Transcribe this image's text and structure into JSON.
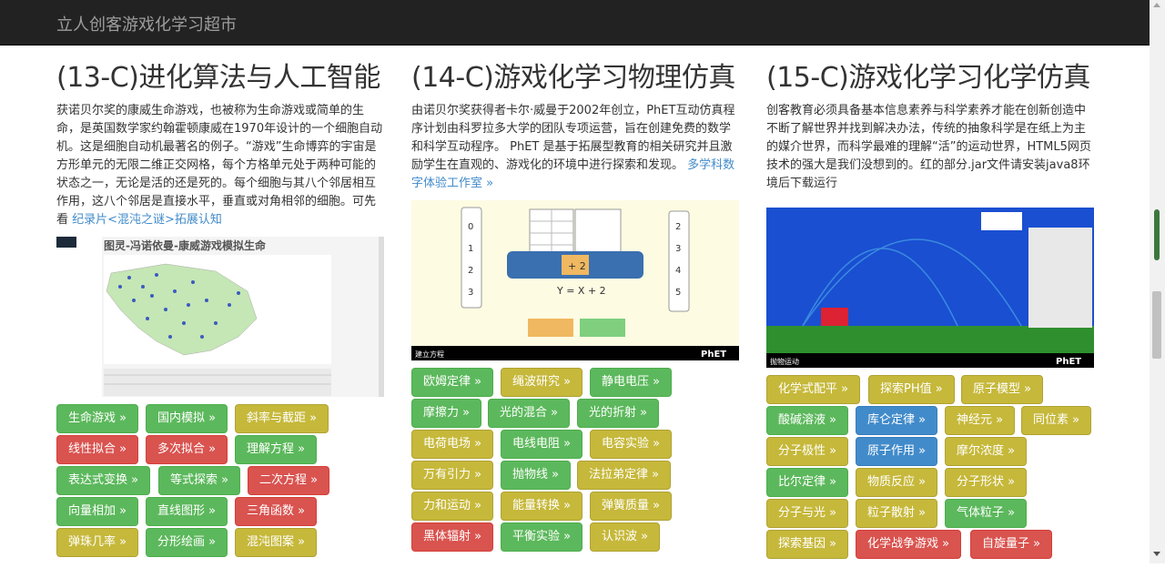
{
  "navbar": {
    "brand": "立人创客游戏化学习超市"
  },
  "columns": [
    {
      "title": "(13-C)进化算法与人工智能",
      "text": "获诺贝尔奖的康威生命游戏，也被称为生命游戏或简单的生命，是英国数学家约翰霍顿康威在1970年设计的一个细胞自动机。这是细胞自动机最著名的例子。“游戏”生命博弈的宇宙是方形单元的无限二维正交网格，每个方格单元处于两种可能的状态之一，无论是活的还是死的。每个细胞与其八个邻居相互作用，这八个邻居是直接水平，垂直或对角相邻的细胞。可先看 ",
      "link": "纪录片<混沌之谜>拓展认知",
      "figure_title": "图灵-冯诺依曼-康威游戏模拟生命",
      "buttons": [
        {
          "label": "生命游戏 »",
          "color": "green"
        },
        {
          "label": "国内模拟 »",
          "color": "green"
        },
        {
          "label": "斜率与截距 »",
          "color": "yellow"
        },
        {
          "label": "线性拟合 »",
          "color": "red"
        },
        {
          "label": "多次拟合 »",
          "color": "red"
        },
        {
          "label": "理解方程 »",
          "color": "green"
        },
        {
          "label": "表达式变换 »",
          "color": "green"
        },
        {
          "label": "等式探索 »",
          "color": "green"
        },
        {
          "label": "二次方程 »",
          "color": "red"
        },
        {
          "label": "向量相加 »",
          "color": "green"
        },
        {
          "label": "直线图形 »",
          "color": "green"
        },
        {
          "label": "三角函数 »",
          "color": "red"
        },
        {
          "label": "弹珠几率 »",
          "color": "yellow"
        },
        {
          "label": "分形绘画 »",
          "color": "green"
        },
        {
          "label": "混沌图案 »",
          "color": "yellow"
        }
      ]
    },
    {
      "title": "(14-C)游戏化学习物理仿真",
      "text": "由诺贝尔奖获得者卡尔·威曼于2002年创立，PhET互动仿真程序计划由科罗拉多大学的团队专项运营，旨在创建免费的数学和科学互动程序。 PhET 是基于拓展型教育的相关研究并且激励学生在直观的、游戏化的环境中进行探索和发现。 ",
      "link": "多学科数字体验工作室 »",
      "figure_equation": "Y = X + 2",
      "figure_label": "建立方程",
      "figure_brand": "PhET",
      "buttons": [
        {
          "label": "欧姆定律 »",
          "color": "green"
        },
        {
          "label": "绳波研究 »",
          "color": "yellow"
        },
        {
          "label": "静电电压 »",
          "color": "green"
        },
        {
          "label": "摩擦力 »",
          "color": "green"
        },
        {
          "label": "光的混合 »",
          "color": "green"
        },
        {
          "label": "光的折射 »",
          "color": "green"
        },
        {
          "label": "电荷电场 »",
          "color": "yellow"
        },
        {
          "label": "电线电阻 »",
          "color": "green"
        },
        {
          "label": "电容实验 »",
          "color": "yellow"
        },
        {
          "label": "万有引力 »",
          "color": "yellow"
        },
        {
          "label": "抛物线 »",
          "color": "green"
        },
        {
          "label": "法拉弟定律 »",
          "color": "yellow"
        },
        {
          "label": "力和运动 »",
          "color": "yellow"
        },
        {
          "label": "能量转换 »",
          "color": "yellow"
        },
        {
          "label": "弹簧质量 »",
          "color": "yellow"
        },
        {
          "label": "黑体辐射 »",
          "color": "red"
        },
        {
          "label": "平衡实验 »",
          "color": "green"
        },
        {
          "label": "认识波 »",
          "color": "yellow"
        }
      ]
    },
    {
      "title": "(15-C)游戏化学习化学仿真",
      "text": "创客教育必须具备基本信息素养与科学素养才能在创新创造中不断了解世界并找到解决办法，传统的抽象科学是在纸上为主的媒介世界，而科学最难的理解“活”的运动世界，HTML5网页技术的强大是我们没想到的。红的部分.jar文件请安装java8环境后下载运行",
      "figure_label": "抛物运动",
      "figure_brand": "PhET",
      "buttons": [
        {
          "label": "化学式配平 »",
          "color": "yellow"
        },
        {
          "label": "探索PH值 »",
          "color": "yellow"
        },
        {
          "label": "原子模型 »",
          "color": "yellow"
        },
        {
          "label": "酸碱溶液 »",
          "color": "green"
        },
        {
          "label": "库仑定律 »",
          "color": "blue"
        },
        {
          "label": "神经元 »",
          "color": "yellow"
        },
        {
          "label": "同位素 »",
          "color": "yellow"
        },
        {
          "label": "分子极性 »",
          "color": "yellow"
        },
        {
          "label": "原子作用 »",
          "color": "blue"
        },
        {
          "label": "摩尔浓度 »",
          "color": "yellow"
        },
        {
          "label": "比尔定律 »",
          "color": "green"
        },
        {
          "label": "物质反应 »",
          "color": "yellow"
        },
        {
          "label": "分子形状 »",
          "color": "yellow"
        },
        {
          "label": "分子与光 »",
          "color": "yellow"
        },
        {
          "label": "粒子散射 »",
          "color": "yellow"
        },
        {
          "label": "气体粒子 »",
          "color": "green"
        },
        {
          "label": "探索基因 »",
          "color": "yellow"
        },
        {
          "label": "化学战争游戏 »",
          "color": "red"
        },
        {
          "label": "自旋量子 »",
          "color": "red"
        }
      ]
    }
  ],
  "colors": {
    "green": "#5cb85c",
    "yellow": "#c6b83a",
    "red": "#d9534f",
    "blue": "#428bca"
  }
}
